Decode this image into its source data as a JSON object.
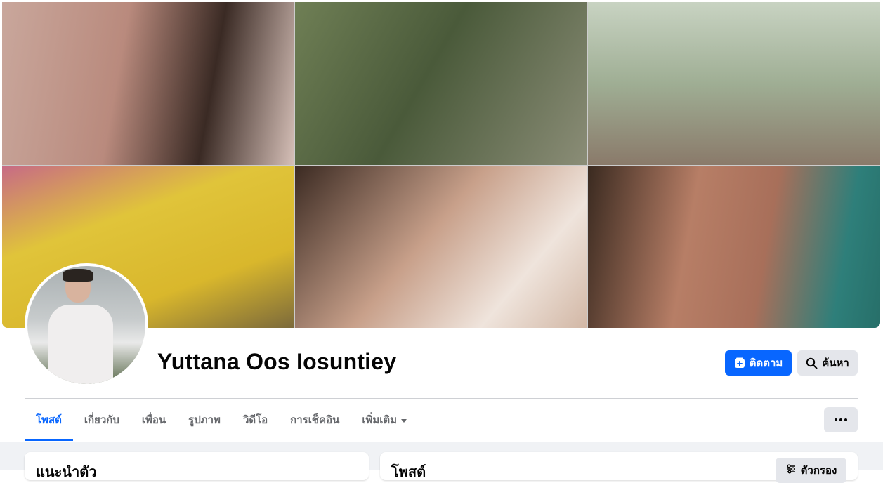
{
  "profile": {
    "name": "Yuttana Oos Iosuntiey"
  },
  "actions": {
    "follow_label": "ติดตาม",
    "search_label": "ค้นหา"
  },
  "tabs": [
    {
      "label": "โพสต์",
      "active": true
    },
    {
      "label": "เกี่ยวกับ",
      "active": false
    },
    {
      "label": "เพื่อน",
      "active": false
    },
    {
      "label": "รูปภาพ",
      "active": false
    },
    {
      "label": "วิดีโอ",
      "active": false
    },
    {
      "label": "การเช็คอิน",
      "active": false
    },
    {
      "label": "เพิ่มเติม",
      "active": false
    }
  ],
  "cards": {
    "intro_title": "แนะนำตัว",
    "posts_title": "โพสต์",
    "filter_label": "ตัวกรอง"
  },
  "colors": {
    "accent": "#0866ff",
    "button_gray": "#e4e6eb",
    "feed_bg": "#f0f2f5"
  },
  "icons": {
    "follow": "follow-plus-icon",
    "search": "search-icon",
    "more": "more-dots-icon",
    "dropdown": "caret-down-icon",
    "filter": "filter-sliders-icon"
  }
}
